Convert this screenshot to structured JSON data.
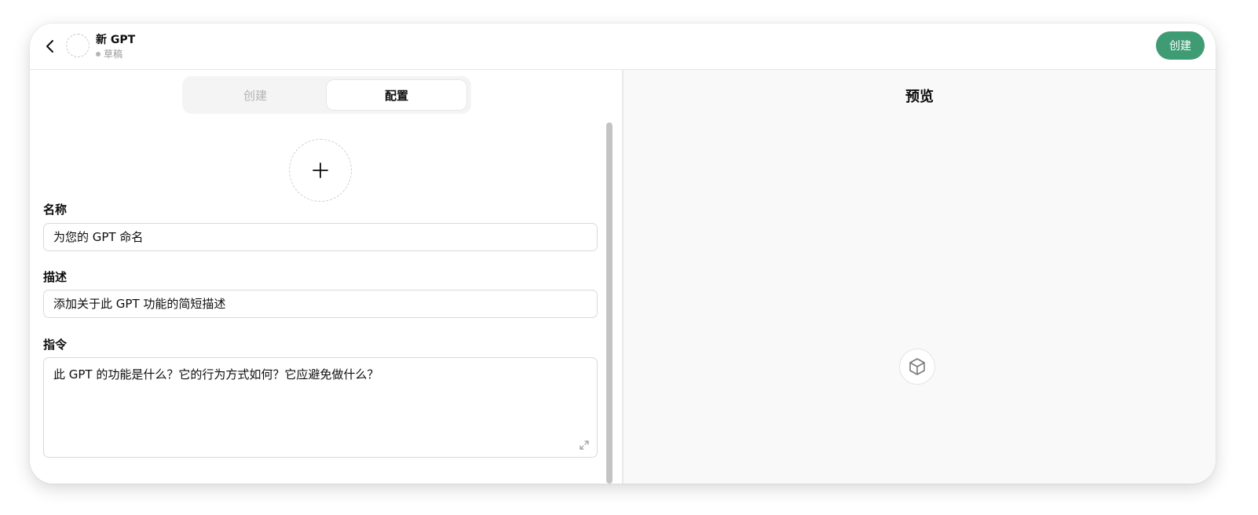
{
  "header": {
    "title": "新 GPT",
    "status": "草稿",
    "create_button": "创建"
  },
  "tabs": [
    {
      "label": "创建",
      "active": false
    },
    {
      "label": "配置",
      "active": true
    }
  ],
  "form": {
    "name": {
      "label": "名称",
      "placeholder": "为您的 GPT 命名"
    },
    "description": {
      "label": "描述",
      "placeholder": "添加关于此 GPT 功能的简短描述"
    },
    "instructions": {
      "label": "指令",
      "placeholder": "此 GPT 的功能是什么？它的行为方式如何？它应避免做什么？"
    }
  },
  "preview": {
    "title": "预览"
  },
  "icons": [
    "back-arrow-icon",
    "plus-icon",
    "expand-icon",
    "cube-icon"
  ],
  "colors": {
    "accent": "#3f9b74",
    "preview_bg": "#f9f9f9",
    "muted_text": "#9b9b9b"
  }
}
